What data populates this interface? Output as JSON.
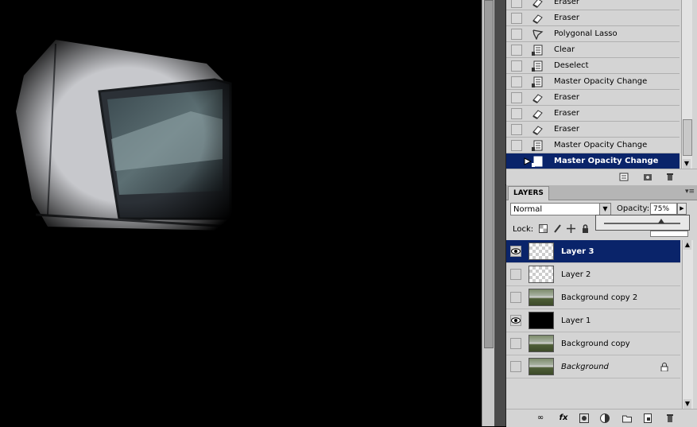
{
  "history": {
    "items": [
      {
        "label": "Eraser",
        "icon": "eraser-icon"
      },
      {
        "label": "Eraser",
        "icon": "eraser-icon"
      },
      {
        "label": "Polygonal Lasso",
        "icon": "polygonal-lasso-icon"
      },
      {
        "label": "Clear",
        "icon": "history-state-icon"
      },
      {
        "label": "Deselect",
        "icon": "history-state-icon"
      },
      {
        "label": "Master Opacity Change",
        "icon": "history-state-icon"
      },
      {
        "label": "Eraser",
        "icon": "eraser-icon"
      },
      {
        "label": "Eraser",
        "icon": "eraser-icon"
      },
      {
        "label": "Eraser",
        "icon": "eraser-icon"
      },
      {
        "label": "Master Opacity Change",
        "icon": "history-state-icon"
      },
      {
        "label": "Master Opacity Change",
        "icon": "history-state-icon",
        "selected": true
      }
    ]
  },
  "layers_panel": {
    "tab_label": "LAYERS",
    "blend_mode": "Normal",
    "opacity_label": "Opacity:",
    "opacity_value": "75%",
    "opacity_slider_level": 0.75,
    "lock_label": "Lock:",
    "layers": [
      {
        "name": "Layer 3",
        "visible": true,
        "thumb": "transparent",
        "selected": true
      },
      {
        "name": "Layer 2",
        "visible": false,
        "thumb": "transparent"
      },
      {
        "name": "Background copy 2",
        "visible": false,
        "thumb": "photo"
      },
      {
        "name": "Layer 1",
        "visible": true,
        "thumb": "black"
      },
      {
        "name": "Background copy",
        "visible": false,
        "thumb": "photo"
      },
      {
        "name": "Background",
        "visible": false,
        "thumb": "photo",
        "locked": true,
        "italic": true
      }
    ]
  },
  "colors": {
    "selection": "#0a246a",
    "panel": "#d4d4d4",
    "canvas": "#000000"
  }
}
